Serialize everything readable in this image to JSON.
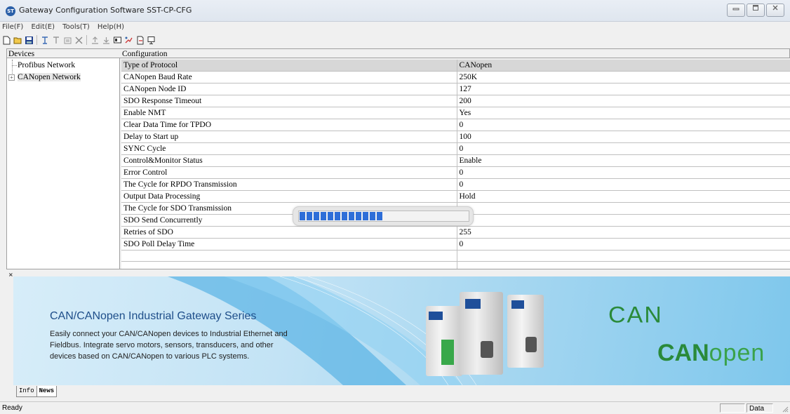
{
  "window": {
    "title": "Gateway Configuration Software SST-CP-CFG",
    "app_icon": "sst-logo-icon",
    "controls": [
      "minimize-icon",
      "maximize-icon",
      "close-icon"
    ]
  },
  "menu": {
    "items": [
      "File(F)",
      "Edit(E)",
      "Tools(T)",
      "Help(H)"
    ]
  },
  "toolbar": {
    "icons": [
      "new-file-icon",
      "open-folder-icon",
      "save-icon",
      "add-device-icon",
      "add-module-icon",
      "properties-icon",
      "delete-icon",
      "upload-icon",
      "download-icon",
      "monitor-icon",
      "settings-icon",
      "export-icon",
      "help-icon"
    ]
  },
  "devices": {
    "header": "Devices",
    "tree": [
      {
        "label": "Profibus Network",
        "expandable": false
      },
      {
        "label": "CANopen Network",
        "expandable": true,
        "selected": true
      }
    ]
  },
  "configuration": {
    "header": "Configuration",
    "rows": [
      {
        "name": "Type of Protocol",
        "value": "CANopen"
      },
      {
        "name": "CANopen Baud Rate",
        "value": "250K"
      },
      {
        "name": "CANopen Node ID",
        "value": "127"
      },
      {
        "name": "SDO Response Timeout",
        "value": "200"
      },
      {
        "name": "Enable NMT",
        "value": "Yes"
      },
      {
        "name": "Clear Data Time for TPDO",
        "value": "0"
      },
      {
        "name": "Delay to Start up",
        "value": "100"
      },
      {
        "name": "SYNC Cycle",
        "value": "0"
      },
      {
        "name": "Control&Monitor Status",
        "value": "Enable"
      },
      {
        "name": "Error Control",
        "value": "0"
      },
      {
        "name": "The Cycle for RPDO Transmission",
        "value": "0"
      },
      {
        "name": "Output Data Processing",
        "value": "Hold"
      },
      {
        "name": "The Cycle for SDO Transmission",
        "value": ""
      },
      {
        "name": "SDO Send Concurrently",
        "value": "able"
      },
      {
        "name": "Retries of SDO",
        "value": "255"
      },
      {
        "name": "SDO Poll Delay Time",
        "value": "0"
      },
      {
        "name": "",
        "value": ""
      },
      {
        "name": "",
        "value": ""
      }
    ]
  },
  "progress": {
    "fraction": 0.48,
    "color": "#2e6ed8"
  },
  "banner": {
    "title": "CAN/CANopen Industrial Gateway Series",
    "description": "Easily connect your CAN/CANopen devices to Industrial Ethernet and Fieldbus. Integrate servo motors, sensors, transducers, and other devices based on CAN/CANopen to various PLC systems.",
    "logo_can": "CAN",
    "logo_canopen_bold": "CAN",
    "logo_canopen_thin": "open",
    "accent_color": "#2a8a3a"
  },
  "bottom_tabs": [
    "Info",
    "News"
  ],
  "status": {
    "text": "Ready",
    "data_label": "Data"
  }
}
